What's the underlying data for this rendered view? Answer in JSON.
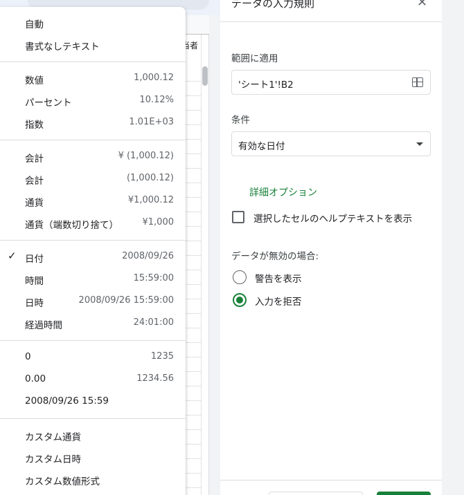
{
  "sheet": {
    "column_header_partial": "当者"
  },
  "panel": {
    "title": "データの入力規則",
    "close_icon": "close-icon",
    "range_label": "範囲に適用",
    "range_value": "'シート1'!B2",
    "range_icon": "grid-icon",
    "condition_label": "条件",
    "condition_value": "有効な日付",
    "advanced_link": "詳細オプション",
    "help_text_checkbox_label": "選択したセルのヘルプテキストを表示",
    "help_text_checked": false,
    "invalid_label": "データが無効の場合:",
    "invalid_options": [
      {
        "label": "警告を表示",
        "selected": false
      },
      {
        "label": "入力を拒否",
        "selected": true
      }
    ],
    "accent_color": "#188038"
  },
  "menu": {
    "groups": [
      [
        {
          "label": "自動",
          "value": ""
        },
        {
          "label": "書式なしテキスト",
          "value": ""
        }
      ],
      [
        {
          "label": "数値",
          "value": "1,000.12"
        },
        {
          "label": "パーセント",
          "value": "10.12%"
        },
        {
          "label": "指数",
          "value": "1.01E+03"
        }
      ],
      [
        {
          "label": "会計",
          "value": "¥ (1,000.12)"
        },
        {
          "label": "会計",
          "value": "(1,000.12)"
        },
        {
          "label": "通貨",
          "value": "¥1,000.12"
        },
        {
          "label": "通貨（端数切り捨て）",
          "value": "¥1,000"
        }
      ],
      [
        {
          "label": "日付",
          "value": "2008/09/26",
          "checked": true
        },
        {
          "label": "時間",
          "value": "15:59:00"
        },
        {
          "label": "日時",
          "value": "2008/09/26 15:59:00"
        },
        {
          "label": "経過時間",
          "value": "24:01:00"
        }
      ],
      [
        {
          "label": "0",
          "value": "1235"
        },
        {
          "label": "0.00",
          "value": "1234.56"
        },
        {
          "label": "2008/09/26 15:59",
          "value": ""
        }
      ],
      [
        {
          "label": "カスタム通貨",
          "value": ""
        },
        {
          "label": "カスタム日時",
          "value": ""
        },
        {
          "label": "カスタム数値形式",
          "value": ""
        }
      ]
    ],
    "check_glyph": "✓"
  }
}
